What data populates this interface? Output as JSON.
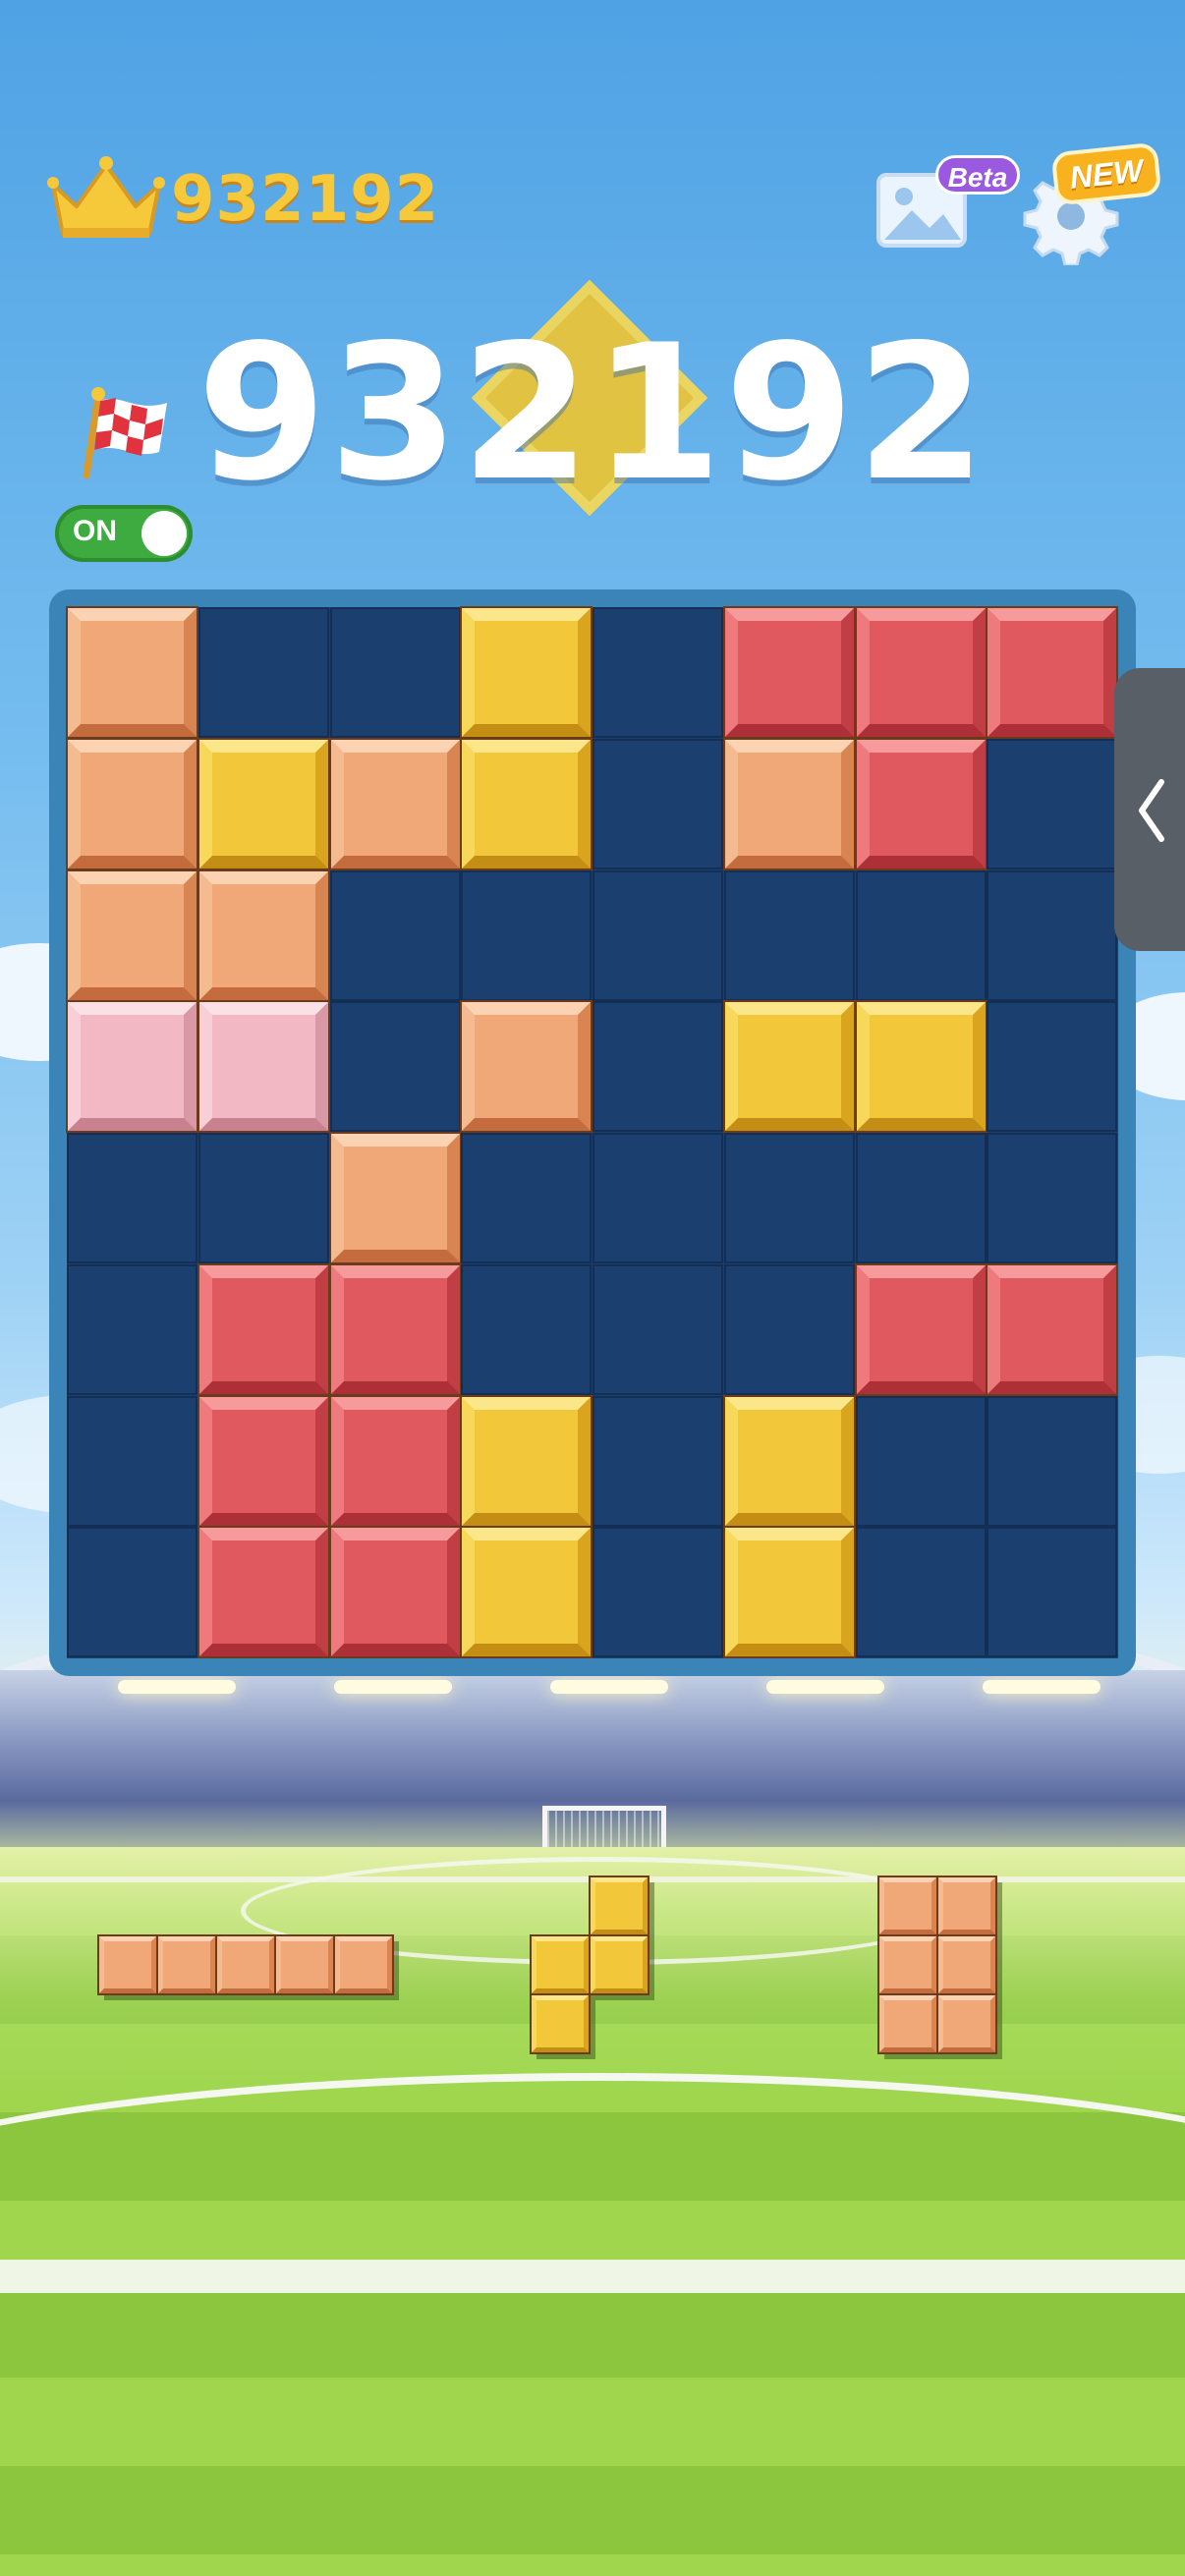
{
  "hud": {
    "best_score": "932192",
    "current_score": "932192",
    "gallery_badge": "Beta",
    "settings_badge": "NEW",
    "toggle_label": "ON",
    "toggle_on": true
  },
  "icons": {
    "best": "crown-icon",
    "gallery": "image-gallery-icon",
    "settings": "gear-icon",
    "flag": "checkered-flag-icon",
    "side_tab": "chevron-left-icon"
  },
  "colors": {
    "orange": "#f0a878",
    "yellow": "#f2c83a",
    "red": "#e0595e",
    "pink": "#f2b8c4",
    "board_bg": "#1b3f6e",
    "frame": "#3a84b8"
  },
  "board": {
    "size": 8,
    "rows": [
      [
        "orange",
        null,
        null,
        "yellow",
        null,
        "red",
        "red",
        "red"
      ],
      [
        "orange",
        "yellow",
        "orange",
        "yellow",
        null,
        "orange",
        "red",
        null
      ],
      [
        "orange",
        "orange",
        null,
        null,
        null,
        null,
        null,
        null
      ],
      [
        "pink",
        "pink",
        null,
        "orange",
        null,
        "yellow",
        "yellow",
        null
      ],
      [
        null,
        null,
        "orange",
        null,
        null,
        null,
        null,
        null
      ],
      [
        null,
        "red",
        "red",
        null,
        null,
        null,
        "red",
        "red"
      ],
      [
        null,
        "red",
        "red",
        "yellow",
        null,
        "yellow",
        null,
        null
      ],
      [
        null,
        "red",
        "red",
        "yellow",
        null,
        "yellow",
        null,
        null
      ]
    ]
  },
  "tray": [
    {
      "color": "orange",
      "cells": [
        [
          0,
          0
        ],
        [
          0,
          1
        ],
        [
          0,
          2
        ],
        [
          0,
          3
        ],
        [
          0,
          4
        ]
      ]
    },
    {
      "color": "yellow",
      "cells": [
        [
          0,
          1
        ],
        [
          1,
          0
        ],
        [
          1,
          1
        ],
        [
          2,
          0
        ]
      ]
    },
    {
      "color": "orange",
      "cells": [
        [
          0,
          0
        ],
        [
          0,
          1
        ],
        [
          1,
          0
        ],
        [
          1,
          1
        ],
        [
          2,
          0
        ],
        [
          2,
          1
        ]
      ]
    }
  ]
}
